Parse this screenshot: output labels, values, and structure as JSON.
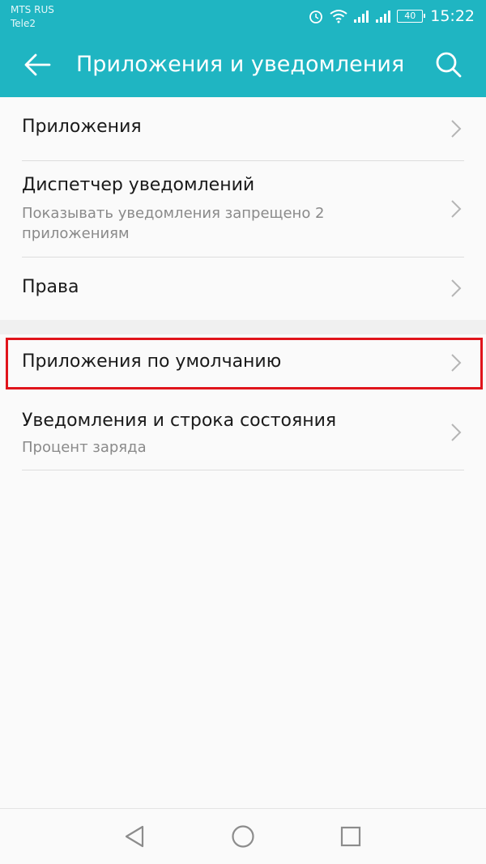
{
  "status_bar": {
    "carrier1": "MTS RUS",
    "carrier2": "Tele2",
    "battery": "40",
    "time": "15:22",
    "icons": [
      "alarm-icon",
      "wifi-icon",
      "signal-icon",
      "signal-icon",
      "battery-icon"
    ]
  },
  "app_bar": {
    "title": "Приложения и уведомления",
    "back_icon": "arrow-left-icon",
    "search_icon": "search-icon",
    "color": "#1fb5c2"
  },
  "settings": {
    "items": [
      {
        "label": "Приложения"
      },
      {
        "label": "Диспетчер уведомлений",
        "sub": "Показывать уведомления запрещено 2 приложениям"
      },
      {
        "label": "Права"
      },
      {
        "label": "Приложения по умолчанию",
        "highlighted": true
      },
      {
        "label": "Уведомления и строка состояния",
        "sub": "Процент заряда"
      }
    ]
  },
  "highlight_color": "#e0141b",
  "nav_bar": {
    "icons": [
      "back-triangle-icon",
      "home-circle-icon",
      "recents-square-icon"
    ]
  }
}
